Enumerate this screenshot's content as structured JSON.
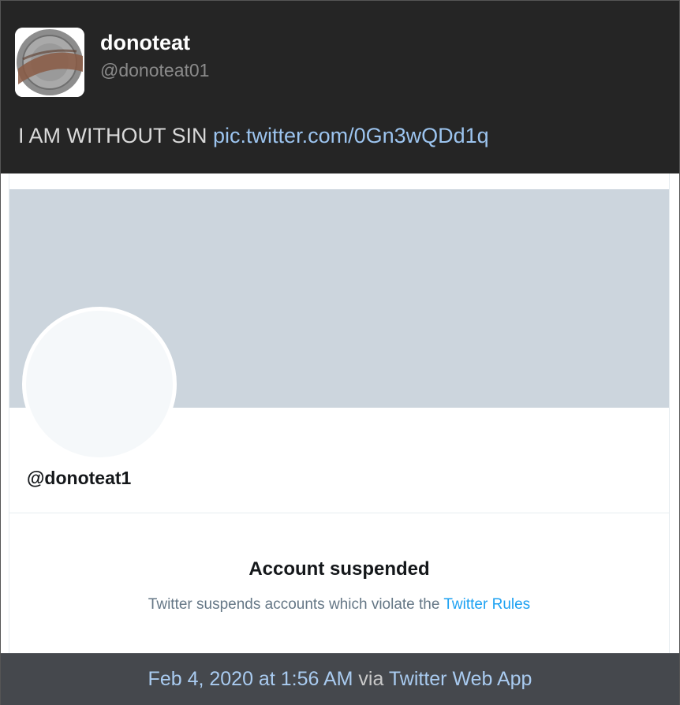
{
  "tweet": {
    "display_name": "donoteat",
    "handle": "@donoteat01",
    "text": "I AM WITHOUT SIN",
    "link": "pic.twitter.com/0Gn3wQDd1q",
    "avatar_icon": "coin-image"
  },
  "embedded_screenshot": {
    "handle": "@donoteat1",
    "title": "Account suspended",
    "subtitle": "Twitter suspends accounts which violate the",
    "rules_link": "Twitter Rules",
    "banner_color": "#ccd5dd",
    "link_color": "#1da1f2"
  },
  "footer": {
    "timestamp": "Feb 4, 2020 at 1:56 AM",
    "via": "via",
    "app": "Twitter Web App"
  }
}
